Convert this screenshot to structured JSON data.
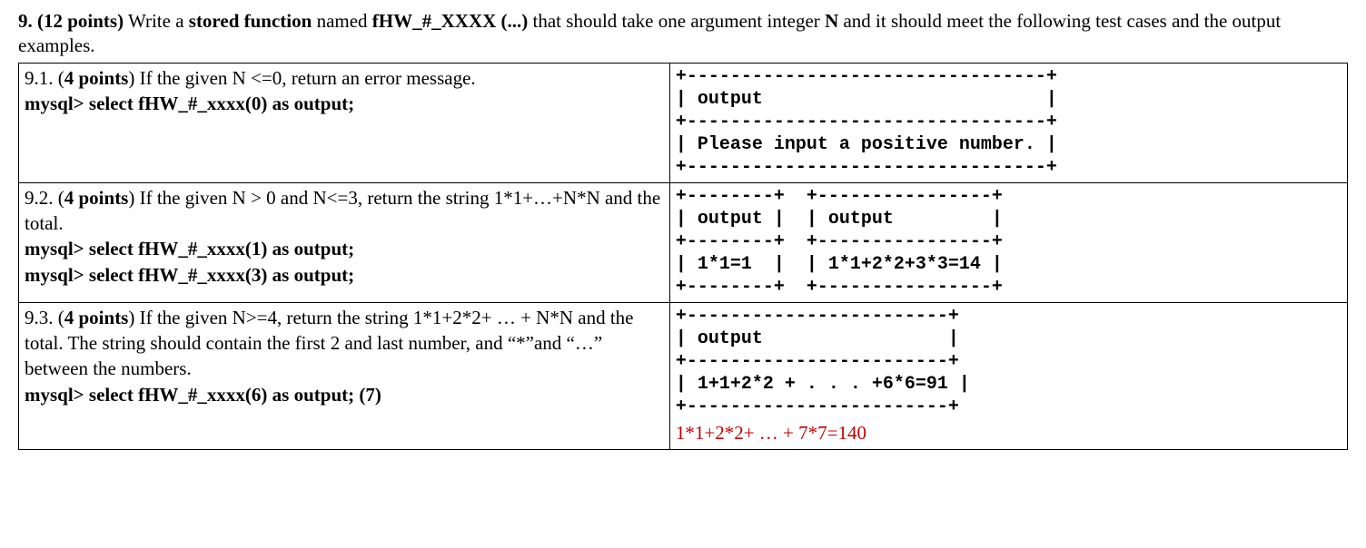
{
  "intro": {
    "num": "9. (12 points)",
    "pre": " Write a ",
    "func_label": "stored function",
    "mid1": " named ",
    "func_name": "fHW_#_XXXX (...)",
    "mid2": " that should take one argument integer ",
    "argname": "N",
    "tail": " and it should meet the following test cases and the output examples."
  },
  "row1": {
    "left_first": "9.1. (",
    "pts": "4 points",
    "left_rest": ") If the given N <=0, return an error message.",
    "mysql": "mysql> select fHW_#_xxxx(0) as output;",
    "term": "+---------------------------------+\n| output                          |\n+---------------------------------+\n| Please input a positive number. |\n+---------------------------------+"
  },
  "row2": {
    "left_first": "9.2. (",
    "pts": "4 points",
    "left_rest": ")  If the given N > 0 and N<=3, return the string 1*1+…+N*N and the total.",
    "mysql1": "mysql> select fHW_#_xxxx(1) as output;",
    "mysql2": "mysql> select fHW_#_xxxx(3) as output;",
    "term": "+--------+  +----------------+\n| output |  | output         |\n+--------+  +----------------+\n| 1*1=1  |  | 1*1+2*2+3*3=14 |\n+--------+  +----------------+"
  },
  "row3": {
    "left_first": "9.3. (",
    "pts": "4 points",
    "left_rest": ") If the given N>=4, return the string 1*1+2*2+ … + N*N and the total. The string should contain the first 2 and last number, and “*”and “…” between the numbers.",
    "mysql": "mysql> select fHW_#_xxxx(6) as output; (7)",
    "term": "+------------------------+\n| output                 |\n+------------------------+\n| 1+1+2*2 + . . . +6*6=91 |\n+------------------------+",
    "extra": "1*1+2*2+ … + 7*7=140"
  }
}
